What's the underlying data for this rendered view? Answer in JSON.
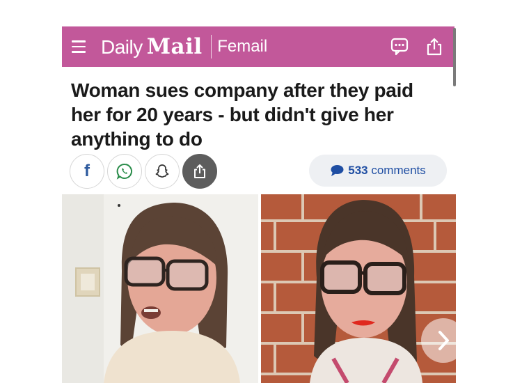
{
  "header": {
    "brand_daily": "Daily",
    "brand_mail": "Mail",
    "section": "Femail",
    "bg_color": "#c2589a",
    "icons": [
      "menu-icon",
      "comment-bubble-icon",
      "share-upload-icon"
    ]
  },
  "article": {
    "headline": "Woman sues company after they paid her for 20 years - but didn't give her anything to do"
  },
  "share": {
    "buttons": [
      "facebook-icon",
      "whatsapp-icon",
      "snapchat-icon",
      "share-icon"
    ],
    "facebook_glyph": "f"
  },
  "comments": {
    "count": "533",
    "label": "comments",
    "color": "#1f4ea3"
  },
  "gallery": {
    "images": [
      "woman-speaking-photo",
      "woman-portrait-brick-wall-photo"
    ],
    "next_icon": "chevron-right-icon"
  }
}
